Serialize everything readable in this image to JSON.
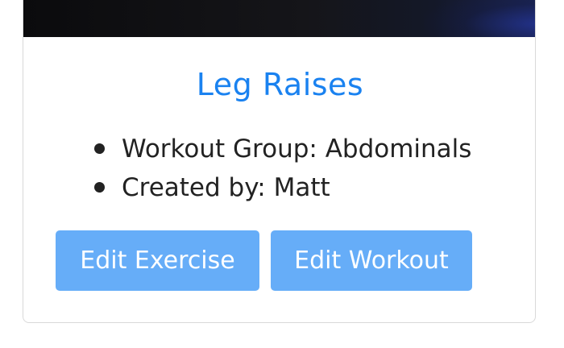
{
  "exercise": {
    "title": "Leg Raises",
    "details": [
      "Workout Group: Abdominals",
      "Created by: Matt"
    ]
  },
  "actions": {
    "edit_exercise_label": "Edit Exercise",
    "edit_workout_label": "Edit Workout"
  },
  "colors": {
    "title": "#1a82f0",
    "button_bg": "#66adf8",
    "button_text": "#ffffff"
  }
}
